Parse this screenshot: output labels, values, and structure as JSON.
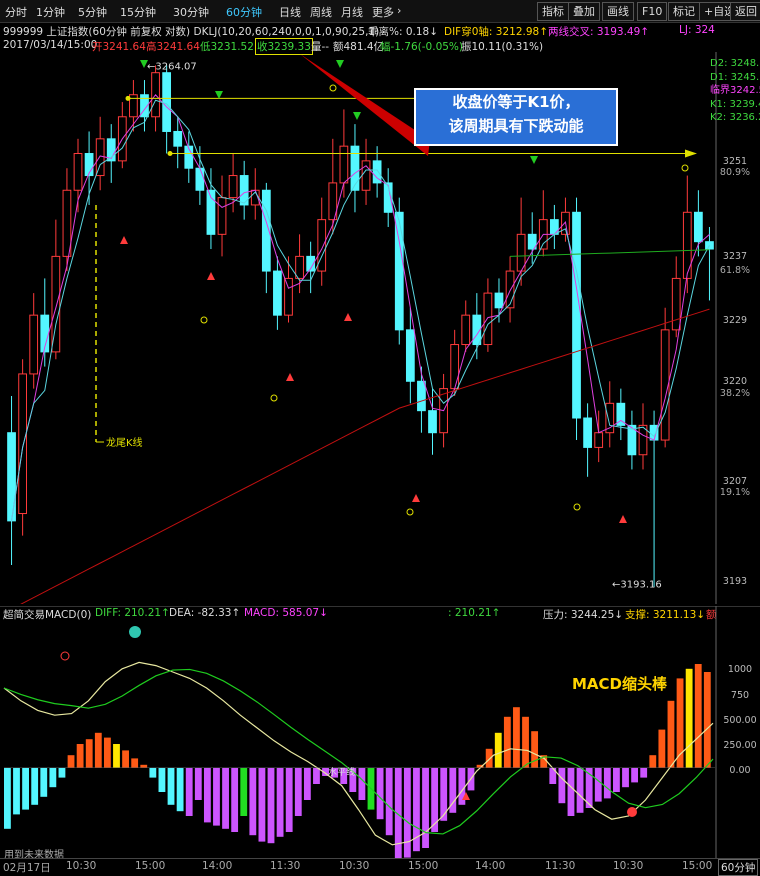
{
  "toolbar": {
    "periods": [
      "分时",
      "1分钟",
      "5分钟",
      "15分钟",
      "30分钟",
      "60分钟",
      "日线",
      "周线",
      "月线",
      "更多"
    ],
    "active_period": "60分钟",
    "more_arrow": "›",
    "buttons": [
      "指标",
      "叠加",
      "画线",
      "F10",
      "标记",
      "+自选",
      "返回"
    ]
  },
  "info": {
    "code": "999999 上证指数(60分钟 前复权 对数) DKLJ(10,20,60,240,0,0,1,0,90,25,1)",
    "qian_li": "乖离%: 0.18↓",
    "dif_zero": "DIF穿0轴: 3212.98↑",
    "two_line_cross": "两线交叉: 3193.49↑",
    "lj": "LJ: 324",
    "date": "2017/03/14/15:00",
    "open": "开3241.64",
    "high": "高3241.64",
    "low": "低3231.52",
    "close": "收3239.33",
    "vol": "量--",
    "amount": "额481.4亿",
    "change": "幅-1.76(-0.05%)",
    "amp": "振10.11(0.31%)"
  },
  "right_panel": {
    "d2": "D2: 3248.83",
    "d1": "D1: 3245.70",
    "crit": "临界3242.56",
    "k1": "K1: 3239.42",
    "k2": "K2: 3236.28"
  },
  "price_axis": [
    {
      "label": "3251",
      "pct": ""
    },
    {
      "label": "",
      "pct": "80.9%"
    },
    {
      "label": "3237",
      "pct": ""
    },
    {
      "label": "",
      "pct": "61.8%"
    },
    {
      "label": "3229",
      "pct": ""
    },
    {
      "label": "3220",
      "pct": ""
    },
    {
      "label": "",
      "pct": "38.2%"
    },
    {
      "label": "3207",
      "pct": ""
    },
    {
      "label": "",
      "pct": "19.1%"
    },
    {
      "label": "3193",
      "pct": ""
    }
  ],
  "annotations": {
    "high_mark": "3264.07",
    "low_mark": "3193.16",
    "dragon_tail": "龙尾K线",
    "callout_line1": "收盘价等于K1价，",
    "callout_line2": "该周期具有下跌动能"
  },
  "macd_head": {
    "name": "超简交易MACD(0)",
    "diff": "DIFF: 210.21↑",
    "dea": "DEA: -82.33↑",
    "macd": "MACD: 585.07↓",
    "val": ": 210.21↑",
    "pressure": "压力: 3244.25↓",
    "support": "支撑: 3211.13↓",
    "tag": "额"
  },
  "macd_axis": [
    "1000",
    "750",
    "500.00",
    "250.00",
    "0.00"
  ],
  "macd_label": "MACD缩头棒",
  "macd_note": "用到未来数据",
  "macd_small_label": "水平线",
  "time_axis": [
    "02月17日",
    "10:30",
    "15:00",
    "14:00",
    "11:30",
    "10:30",
    "15:00",
    "14:00",
    "11:30",
    "10:30",
    "15:00"
  ],
  "period_tag": "60分钟",
  "colors": {
    "up": "#ff3b3b",
    "down": "#54f6ff",
    "ma_purple": "#e040e0",
    "ma_red": "#c01010",
    "ma_green": "#1faa1f",
    "ma_cyan": "#5bd6e0",
    "yellow": "#e0e000"
  },
  "chart_data": {
    "type": "candlestick",
    "ylim": [
      3193,
      3265
    ],
    "candles": [
      [
        3214,
        3202,
        3219,
        3196
      ],
      [
        3203,
        3222,
        3224,
        3200
      ],
      [
        3222,
        3230,
        3233,
        3220
      ],
      [
        3230,
        3225,
        3235,
        3223
      ],
      [
        3225,
        3238,
        3243,
        3224
      ],
      [
        3238,
        3247,
        3250,
        3236
      ],
      [
        3247,
        3252,
        3254,
        3244
      ],
      [
        3252,
        3249,
        3255,
        3245
      ],
      [
        3249,
        3254,
        3257,
        3247
      ],
      [
        3254,
        3251,
        3256,
        3248
      ],
      [
        3251,
        3257,
        3259,
        3250
      ],
      [
        3257,
        3260,
        3262,
        3255
      ],
      [
        3260,
        3257,
        3262,
        3255
      ],
      [
        3257,
        3263,
        3264,
        3255
      ],
      [
        3263,
        3255,
        3264,
        3252
      ],
      [
        3255,
        3253,
        3257,
        3250
      ],
      [
        3253,
        3250,
        3255,
        3248
      ],
      [
        3250,
        3247,
        3253,
        3245
      ],
      [
        3247,
        3241,
        3250,
        3239
      ],
      [
        3241,
        3246,
        3249,
        3238
      ],
      [
        3246,
        3249,
        3252,
        3244
      ],
      [
        3249,
        3245,
        3251,
        3243
      ],
      [
        3245,
        3247,
        3250,
        3243
      ],
      [
        3247,
        3236,
        3248,
        3233
      ],
      [
        3236,
        3230,
        3238,
        3228
      ],
      [
        3230,
        3235,
        3238,
        3229
      ],
      [
        3235,
        3238,
        3241,
        3233
      ],
      [
        3238,
        3236,
        3240,
        3233
      ],
      [
        3236,
        3243,
        3246,
        3234
      ],
      [
        3243,
        3248,
        3254,
        3241
      ],
      [
        3248,
        3253,
        3258,
        3246
      ],
      [
        3253,
        3247,
        3256,
        3244
      ],
      [
        3247,
        3251,
        3254,
        3245
      ],
      [
        3251,
        3248,
        3253,
        3246
      ],
      [
        3248,
        3244,
        3250,
        3242
      ],
      [
        3244,
        3228,
        3246,
        3226
      ],
      [
        3228,
        3221,
        3231,
        3218
      ],
      [
        3221,
        3217,
        3223,
        3214
      ],
      [
        3217,
        3214,
        3220,
        3211
      ],
      [
        3214,
        3220,
        3222,
        3212
      ],
      [
        3220,
        3226,
        3228,
        3219
      ],
      [
        3226,
        3230,
        3232,
        3225
      ],
      [
        3230,
        3226,
        3233,
        3224
      ],
      [
        3226,
        3233,
        3235,
        3225
      ],
      [
        3233,
        3231,
        3235,
        3229
      ],
      [
        3231,
        3236,
        3238,
        3229
      ],
      [
        3236,
        3241,
        3246,
        3234
      ],
      [
        3241,
        3239,
        3244,
        3237
      ],
      [
        3239,
        3243,
        3247,
        3238
      ],
      [
        3243,
        3241,
        3245,
        3239
      ],
      [
        3241,
        3244,
        3246,
        3240
      ],
      [
        3244,
        3216,
        3246,
        3213
      ],
      [
        3216,
        3212,
        3218,
        3208
      ],
      [
        3212,
        3214,
        3217,
        3210
      ],
      [
        3214,
        3218,
        3221,
        3212
      ],
      [
        3218,
        3215,
        3220,
        3213
      ],
      [
        3215,
        3211,
        3217,
        3209
      ],
      [
        3211,
        3215,
        3218,
        3209
      ],
      [
        3215,
        3213,
        3217,
        3193
      ],
      [
        3213,
        3228,
        3231,
        3212
      ],
      [
        3228,
        3235,
        3238,
        3227
      ],
      [
        3235,
        3244,
        3249,
        3233
      ],
      [
        3244,
        3240,
        3247,
        3238
      ],
      [
        3240,
        3239,
        3242,
        3232
      ]
    ],
    "macd_hist": [
      -380,
      -290,
      -260,
      -230,
      -180,
      -120,
      -60,
      80,
      150,
      180,
      220,
      190,
      150,
      110,
      60,
      20,
      -60,
      -150,
      -230,
      -270,
      -300,
      -200,
      -340,
      -360,
      -380,
      -400,
      -300,
      -420,
      -460,
      -470,
      -430,
      -400,
      -300,
      -200,
      -100,
      -50,
      -60,
      -100,
      -150,
      -200,
      -260,
      -320,
      -420,
      -580,
      -560,
      -520,
      -500,
      -400,
      -330,
      -280,
      -230,
      -140,
      20,
      120,
      220,
      320,
      380,
      320,
      230,
      80,
      -100,
      -220,
      -300,
      -280,
      -250,
      -210,
      -190,
      -150,
      -120,
      -90,
      -60,
      80,
      240,
      420,
      560,
      620,
      650,
      600
    ],
    "x_time_labels": [
      "02月17日",
      "10:30",
      "15:00",
      "14:00",
      "11:30",
      "10:30",
      "15:00",
      "14:00",
      "11:30",
      "10:30",
      "15:00"
    ]
  }
}
